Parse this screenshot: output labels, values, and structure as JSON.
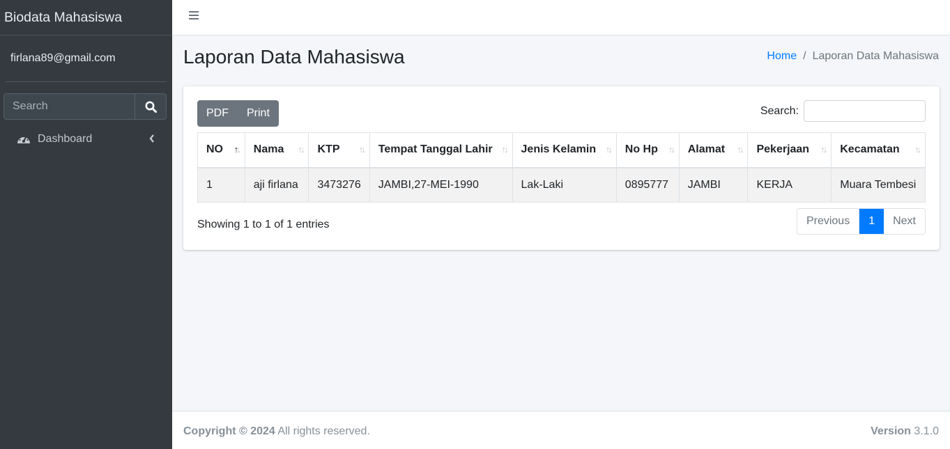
{
  "sidebar": {
    "brand": "Biodata Mahasiswa",
    "user": "firlana89@gmail.com",
    "search_placeholder": "Search",
    "nav": {
      "dashboard": "Dashboard"
    }
  },
  "header": {
    "title": "Laporan Data Mahasiswa",
    "breadcrumb": {
      "home": "Home",
      "separator": "/",
      "current": "Laporan Data Mahasiswa"
    }
  },
  "toolbar": {
    "pdf": "PDF",
    "print": "Print",
    "search_label": "Search:"
  },
  "table": {
    "columns": [
      "NO",
      "Nama",
      "KTP",
      "Tempat Tanggal Lahir",
      "Jenis Kelamin",
      "No Hp",
      "Alamat",
      "Pekerjaan",
      "Kecamatan"
    ],
    "rows": [
      [
        "1",
        "aji firlana",
        "3473276",
        "JAMBI,27-MEI-1990",
        "Lak-Laki",
        "0895777",
        "JAMBI",
        "KERJA",
        "Muara Tembesi"
      ]
    ]
  },
  "pagination": {
    "info": "Showing 1 to 1 of 1 entries",
    "previous": "Previous",
    "current": "1",
    "next": "Next"
  },
  "footer": {
    "copyright": "Copyright © 2024",
    "rights": "All rights reserved.",
    "version_label": "Version",
    "version": "3.1.0"
  },
  "colors": {
    "sidebar": "#343a40",
    "accent": "#007bff",
    "button": "#6c757d",
    "background": "#f4f6f9"
  }
}
